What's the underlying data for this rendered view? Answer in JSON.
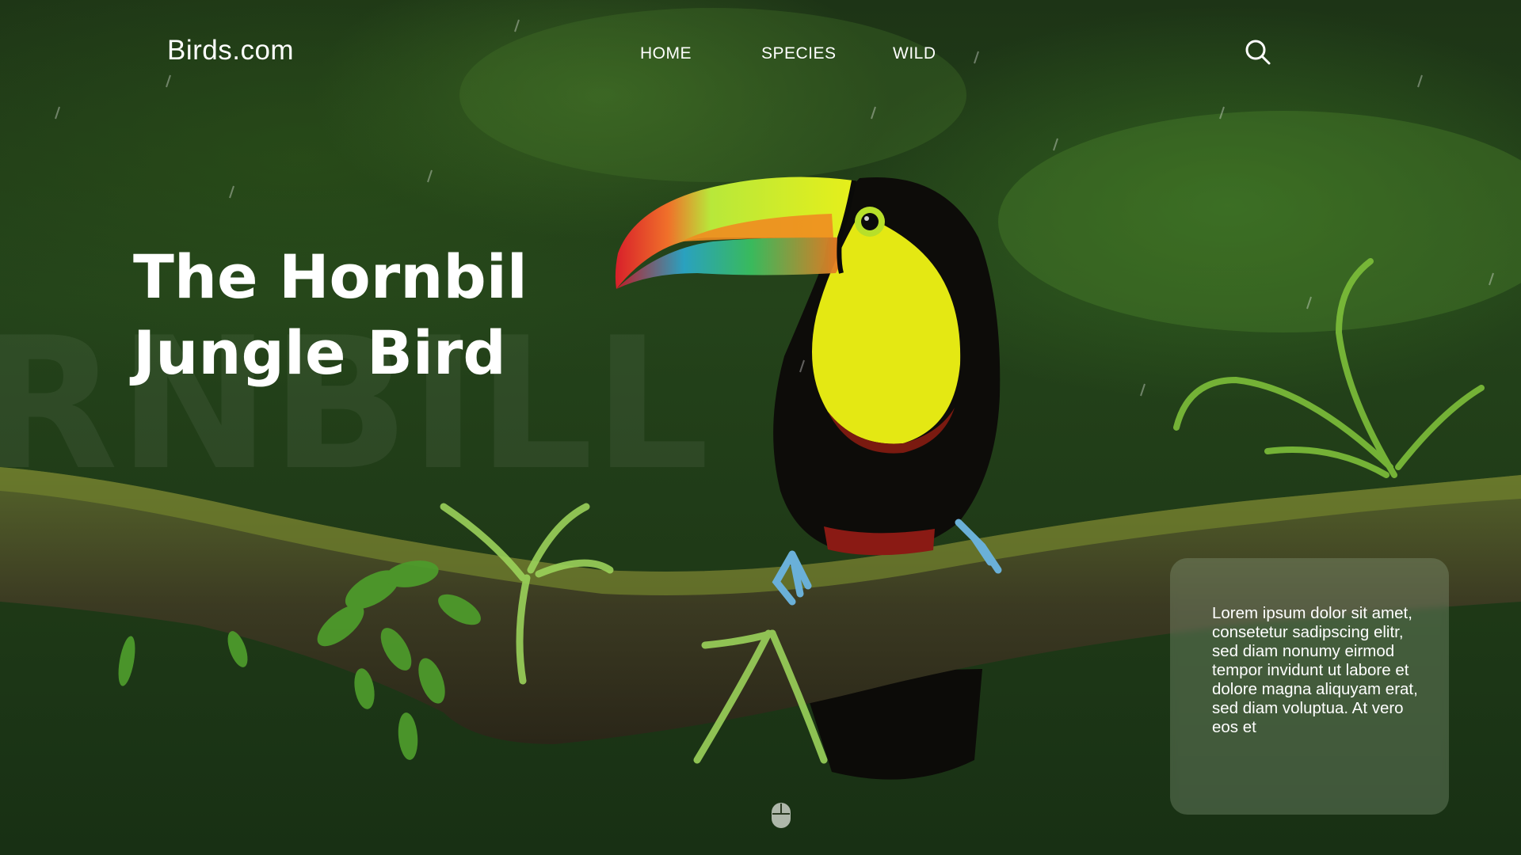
{
  "site": {
    "logo_text": "Birds.com"
  },
  "nav": {
    "links": [
      "HOME",
      "SPECIES",
      "WILD"
    ]
  },
  "hero": {
    "title_line1": "The Hornbil",
    "title_line2": "Jungle Bird",
    "background_word": "RNBILL"
  },
  "info_card": {
    "text": "Lorem ipsum dolor sit amet, consetetur sadipscing elitr, sed diam nonumy eirmod tempor invidunt ut labore et dolore magna aliquyam erat, sed diam voluptua. At vero eos et"
  },
  "icons": {
    "search": "search-icon",
    "scroll": "mouse-scroll-icon"
  },
  "colors": {
    "bg_dark": "#1d3416",
    "accent_yellow": "#e8ea1a",
    "text": "#ffffff"
  }
}
